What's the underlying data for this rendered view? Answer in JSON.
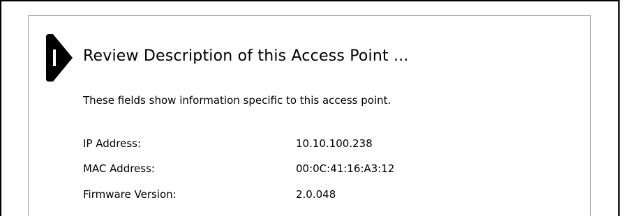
{
  "heading": "Review Description of this Access Point ...",
  "intro": "These fields show information specific to this access point.",
  "fields": [
    {
      "label": "IP Address:",
      "value": "10.10.100.238"
    },
    {
      "label": "MAC Address:",
      "value": "00:0C:41:16:A3:12"
    },
    {
      "label": "Firmware Version:",
      "value": "2.0.048"
    }
  ],
  "icons": {
    "step_marker": "step-arrow-icon"
  },
  "colors": {
    "text": "#000000",
    "panel_border": "#9a9a9a",
    "frame_border": "#000000",
    "marker": "#000000"
  }
}
